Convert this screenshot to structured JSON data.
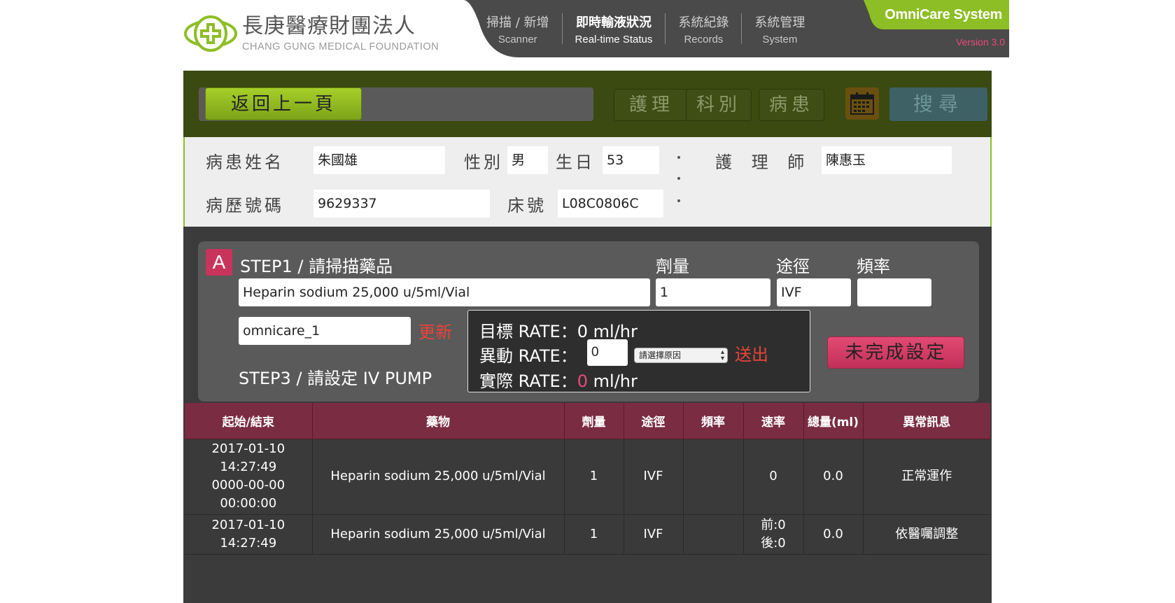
{
  "header": {
    "logo_cn": "長庚醫療財團法人",
    "logo_en": "CHANG GUNG MEDICAL FOUNDATION",
    "nav": [
      {
        "cn": "掃描 / 新增",
        "en": "Scanner"
      },
      {
        "cn": "即時輸液狀況",
        "en": "Real-time Status"
      },
      {
        "cn": "系統紀錄",
        "en": "Records"
      },
      {
        "cn": "系統管理",
        "en": "System"
      }
    ],
    "brand": "OmniCare System",
    "version": "Version 3.0",
    "accent": "#8dbe25",
    "nav_bg": "#4a4a4a"
  },
  "toolbar": {
    "back_label": "返回上一頁",
    "nursing_label": "護理",
    "department_label": "科別",
    "patient_label": "病患",
    "calendar_icon": "calendar-icon",
    "search_label": "搜尋"
  },
  "patient": {
    "name_label": "病患姓名",
    "name": "朱國雄",
    "gender_label": "性別",
    "gender": "男",
    "birthday_label": "生日",
    "birthday": "53",
    "nurse_label": "護 理 師",
    "nurse": "陳惠玉",
    "chart_label": "病歷號碼",
    "chart_no": "9629337",
    "bed_label": "床號",
    "bed_no": "L08C0806C"
  },
  "step": {
    "badge": "A",
    "step1_label": "STEP1 / 請掃描藥品",
    "dose_label": "劑量",
    "route_label": "途徑",
    "freq_label": "頻率",
    "drug": "Heparin sodium  25,000 u/5ml/Vial",
    "dose": "1",
    "route": "IVF",
    "freq": "",
    "pump_id": "omnicare_1",
    "update_label": "更新",
    "step3_label": "STEP3 / 請設定 IV PUMP",
    "target_rate_label": "目標 RATE：",
    "target_rate_value": "0",
    "rate_unit": "ml/hr",
    "change_rate_label": "異動 RATE：",
    "change_rate_value": "0",
    "reason_placeholder": "請選擇原因",
    "send_label": "送出",
    "actual_rate_label": "實際 RATE：",
    "actual_rate_value": "0",
    "unfinished_label": "未完成設定"
  },
  "table": {
    "headers": [
      "起始/結束",
      "藥物",
      "劑量",
      "途徑",
      "頻率",
      "速率",
      "總量(ml)",
      "異常訊息"
    ],
    "rows": [
      {
        "time": [
          "2017-01-10",
          "14:27:49",
          "0000-00-00",
          "00:00:00"
        ],
        "drug": "Heparin sodium 25,000 u/5ml/Vial",
        "dose": "1",
        "route": "IVF",
        "freq": "",
        "rate": [
          "0"
        ],
        "total": "0.0",
        "message": "正常運作"
      },
      {
        "time": [
          "2017-01-10",
          "14:27:49"
        ],
        "drug": "Heparin sodium 25,000 u/5ml/Vial",
        "dose": "1",
        "route": "IVF",
        "freq": "",
        "rate": [
          "前:0",
          "後:0"
        ],
        "total": "0.0",
        "message": "依醫囑調整"
      }
    ]
  }
}
